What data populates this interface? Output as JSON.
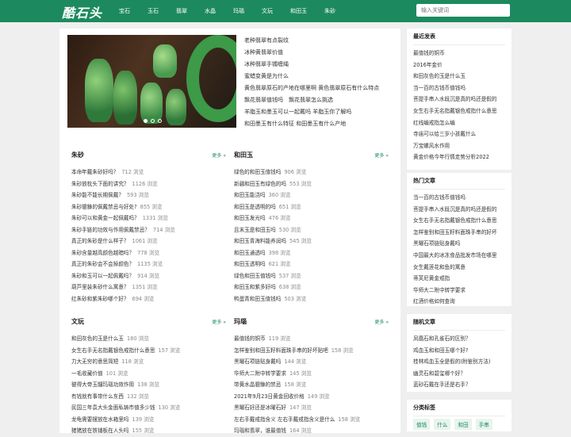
{
  "header": {
    "logo": "酷石头",
    "nav": [
      "宝石",
      "玉石",
      "翡翠",
      "水晶",
      "玛瑙",
      "文玩",
      "和田玉",
      "朱砂"
    ],
    "search_placeholder": "输入关键词"
  },
  "top_links": [
    "老种翡翠有点裂纹",
    "冰种黄翡翠价值",
    "冰种翡翠手镯缠绳",
    "蜜蜡变黄是为什么",
    "黄色翡翠原石的产地在哪里啊 黄色翡翠原石有什么特点",
    "飘花翡翠值钱吗　飘花翡翠怎么挑选",
    "羊脂玉和墨玉可以一起戴吗 羊脂玉你了解吗",
    "和田墨玉有什么特征 和田墨玉有什么产地"
  ],
  "more_label": "更多 »",
  "sections": {
    "zhusha": {
      "title": "朱砂",
      "items": [
        {
          "t": "本命年戴朱砂好吗？",
          "v": "712 浏览"
        },
        {
          "t": "朱砂放枕头下面的讲究？",
          "v": "1126 浏览"
        },
        {
          "t": "朱砂能不能长期佩戴？",
          "v": "593 浏览"
        },
        {
          "t": "朱砂貔貅的佩戴禁忌与好处?",
          "v": "855 浏览"
        },
        {
          "t": "朱砂可以和黄金一起佩戴吗？",
          "v": "1331 浏览"
        },
        {
          "t": "朱砂手链的功效与作用佩戴禁忌？",
          "v": "714 浏览"
        },
        {
          "t": "真正的朱砂是什么样子？",
          "v": "1061 浏览"
        },
        {
          "t": "朱砂含量越高颜色越暗吗？",
          "v": "778 浏览"
        },
        {
          "t": "真正的朱砂会不会掉颜色？",
          "v": "1135 浏览"
        },
        {
          "t": "朱砂和玉可以一起佩戴吗？",
          "v": "914 浏览"
        },
        {
          "t": "葫芦里装朱砂什么寓意？",
          "v": "1351 浏览"
        },
        {
          "t": "红朱砂和紫朱砂哪个好？",
          "v": "694 浏览"
        }
      ]
    },
    "hetian": {
      "title": "和田玉",
      "items": [
        {
          "t": "绿色的和田玉值钱吗",
          "v": "906 浏览"
        },
        {
          "t": "新疆和田玉有绿色的吗",
          "v": "553 浏览"
        },
        {
          "t": "和田玉能浇吗",
          "v": "360 浏览"
        },
        {
          "t": "和田玉是透明的吗",
          "v": "651 浏览"
        },
        {
          "t": "和田玉发光吗",
          "v": "476 浏览"
        },
        {
          "t": "且末玉是和田玉吗",
          "v": "530 浏览"
        },
        {
          "t": "和田玉青海料能养润吗",
          "v": "545 浏览"
        },
        {
          "t": "和田玉通透吗",
          "v": "398 浏览"
        },
        {
          "t": "和田玉透明吗",
          "v": "621 浏览"
        },
        {
          "t": "绿色和田玉值钱吗",
          "v": "537 浏览"
        },
        {
          "t": "和田玉和紫多好吗",
          "v": "638 浏览"
        },
        {
          "t": "鸭蛋青和田玉值钱吗",
          "v": "503 浏览"
        }
      ]
    },
    "wenwan": {
      "title": "文玩",
      "items": [
        {
          "t": "和田灰色的玉是什么玉",
          "v": "180 浏览"
        },
        {
          "t": "女生右手无名指戴银色戒指什么意思",
          "v": "157 浏览"
        },
        {
          "t": "力大无穷的意思简短",
          "v": "118 浏览"
        },
        {
          "t": "一毛收藏价值",
          "v": "101 浏览"
        },
        {
          "t": "彼得大帝玉髓玛瑙功效作用",
          "v": "138 浏览"
        },
        {
          "t": "有钱就有事带什么东西",
          "v": "132 浏览"
        },
        {
          "t": "民国三年袁大头金面私铸市值多少钱",
          "v": "130 浏览"
        },
        {
          "t": "龙龟需要摆放在水箱里吗",
          "v": "139 浏览"
        },
        {
          "t": "猪猪放在铁铺板在人头吗",
          "v": "155 浏览"
        }
      ]
    },
    "manao": {
      "title": "玛瑙",
      "items": [
        {
          "t": "最值钱的铜币",
          "v": "119 浏览"
        },
        {
          "t": "怎样鉴别和田玉籽料面珠手串的好坏贴吧",
          "v": "158 浏览"
        },
        {
          "t": "黑曜石项链贴身戴吗",
          "v": "144 浏览"
        },
        {
          "t": "华师大二附中转学要求",
          "v": "145 浏览"
        },
        {
          "t": "带黄水晶貔貅的禁忌",
          "v": "158 浏览"
        },
        {
          "t": "2021年9月23日黄金回收价格",
          "v": "149 浏览"
        },
        {
          "t": "黑曜石好还是冰曜石好",
          "v": "147 浏览"
        },
        {
          "t": "左右手戴戒指含义 左右手戴戒指含义是什么",
          "v": "158 浏览"
        },
        {
          "t": "玛瑙和翡翠，谁最值钱",
          "v": "164 浏览"
        }
      ]
    }
  },
  "sidebar": {
    "latest": {
      "title": "最近发表",
      "items": [
        "最值钱的铜币",
        "2016年金价",
        "和田灰色的玉是什么玉",
        "当一百的古钱币值钱吗",
        "菩提手串入水既沉是真的吗还是假的",
        "女生右手无名指戴银色戒指什么意思",
        "红线编戒指怎么编",
        "寺庙可以给三岁小孩戴什么",
        "万宝螺风水作用",
        "黄金价格今年行情走势分析2022"
      ]
    },
    "hot": {
      "title": "热门文章",
      "items": [
        "当一百的古钱币值钱吗",
        "菩提手串入水既沉是真的吗还是假的",
        "女生右手无名指戴银色戒指什么意思",
        "怎样鉴别和田玉籽料面珠手串的好坏",
        "黑曜石项链贴身戴吗",
        "中国最大的冰冻食品批发市场在哪里",
        "女生戴莲花和鱼的寓意",
        "蒂芙尼黄金戒指",
        "华师大二附中转学要求",
        "红酒价格如何查询"
      ]
    },
    "random": {
      "title": "随机文章",
      "items": [
        "凤凰石和孔雀石的区别？",
        "鸡血玉和和田玉哪个好?",
        "桂林鸡血玉全是假的(附鉴别方法)",
        "幽灵石和碧玺哪个好？",
        "蓝砂石戴在手还是右手？"
      ]
    },
    "tags": {
      "title": "分类标签",
      "items": [
        "值钱",
        "什么",
        "和田",
        "手串"
      ]
    }
  }
}
